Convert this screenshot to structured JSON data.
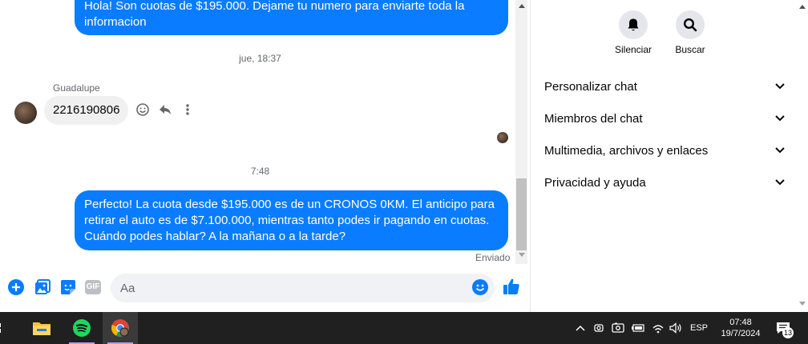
{
  "chat": {
    "messages": [
      {
        "direction": "out",
        "text": "Hola! Son cuotas de $195.000. Dejame tu numero para enviarte toda la informacion"
      },
      {
        "direction": "in",
        "sender": "Guadalupe",
        "text": "2216190806"
      },
      {
        "direction": "out",
        "text": "Perfecto! La cuota desde $195.000 es de un CRONOS 0KM. El anticipo para retirar el auto es de $7.100.000, mientras tanto podes ir pagando en cuotas. Cuándo podes hablar? A la mañana o a la tarde?"
      }
    ],
    "timestamp_1": "jue, 18:37",
    "timestamp_2": "7:48",
    "sent_status": "Enviado",
    "accent_color": "#0a7cff"
  },
  "composer": {
    "placeholder": "Aa",
    "gif_label": "GIF"
  },
  "info_panel": {
    "mute_label": "Silenciar",
    "search_label": "Buscar",
    "sections": [
      "Personalizar chat",
      "Miembros del chat",
      "Multimedia, archivos y enlaces",
      "Privacidad y ayuda"
    ]
  },
  "taskbar": {
    "language": "ESP",
    "time": "07:48",
    "date": "19/7/2024",
    "notifications": "13"
  }
}
